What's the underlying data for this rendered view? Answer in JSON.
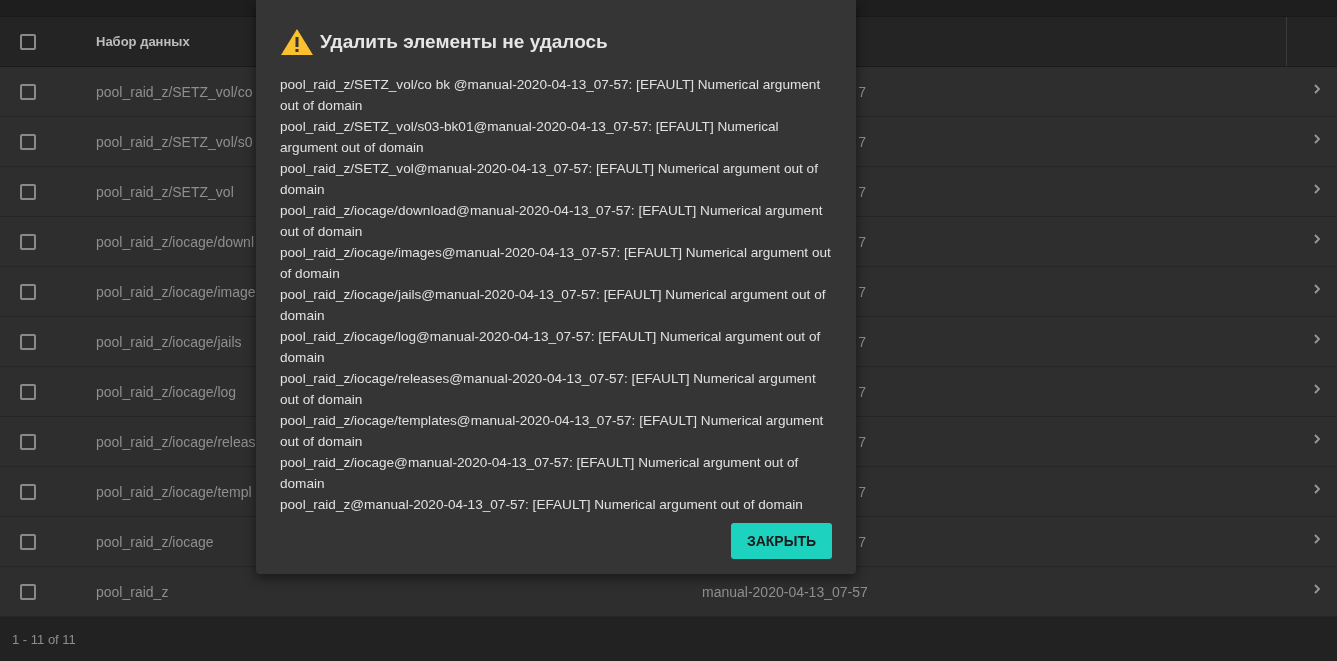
{
  "table": {
    "columns": [
      {
        "label": "Набор данных"
      }
    ],
    "rows": [
      {
        "checked": false,
        "dataset": "pool_raid_z/SETZ_vol/co",
        "snapshot": "7"
      },
      {
        "checked": false,
        "dataset": "pool_raid_z/SETZ_vol/s0",
        "snapshot": "7"
      },
      {
        "checked": false,
        "dataset": "pool_raid_z/SETZ_vol",
        "snapshot": "7"
      },
      {
        "checked": false,
        "dataset": "pool_raid_z/iocage/downl",
        "snapshot": "7"
      },
      {
        "checked": false,
        "dataset": "pool_raid_z/iocage/image",
        "snapshot": "7"
      },
      {
        "checked": false,
        "dataset": "pool_raid_z/iocage/jails",
        "snapshot": "7"
      },
      {
        "checked": false,
        "dataset": "pool_raid_z/iocage/log",
        "snapshot": "7"
      },
      {
        "checked": false,
        "dataset": "pool_raid_z/iocage/releas",
        "snapshot": "7"
      },
      {
        "checked": false,
        "dataset": "pool_raid_z/iocage/templ",
        "snapshot": "7"
      },
      {
        "checked": false,
        "dataset": "pool_raid_z/iocage",
        "snapshot": "7"
      },
      {
        "checked": false,
        "dataset": "pool_raid_z",
        "snapshot": "manual-2020-04-13_07-57"
      }
    ],
    "select_all": {
      "checked": false
    },
    "paginator": "1 - 11 of 11"
  },
  "dialog": {
    "title": "Удалить элементы не удалось",
    "messages": [
      "pool_raid_z/SETZ_vol/co bk @manual-2020-04-13_07-57: [EFAULT] Numerical argument out of domain",
      "pool_raid_z/SETZ_vol/s03-bk01@manual-2020-04-13_07-57: [EFAULT] Numerical argument out of domain",
      "pool_raid_z/SETZ_vol@manual-2020-04-13_07-57: [EFAULT] Numerical argument out of domain",
      "pool_raid_z/iocage/download@manual-2020-04-13_07-57: [EFAULT] Numerical argument out of domain",
      "pool_raid_z/iocage/images@manual-2020-04-13_07-57: [EFAULT] Numerical argument out of domain",
      "pool_raid_z/iocage/jails@manual-2020-04-13_07-57: [EFAULT] Numerical argument out of domain",
      "pool_raid_z/iocage/log@manual-2020-04-13_07-57: [EFAULT] Numerical argument out of domain",
      "pool_raid_z/iocage/releases@manual-2020-04-13_07-57: [EFAULT] Numerical argument out of domain",
      "pool_raid_z/iocage/templates@manual-2020-04-13_07-57: [EFAULT] Numerical argument out of domain",
      "pool_raid_z/iocage@manual-2020-04-13_07-57: [EFAULT] Numerical argument out of domain",
      "pool_raid_z@manual-2020-04-13_07-57: [EFAULT] Numerical argument out of domain"
    ],
    "button": "ЗАКРЫТЬ"
  }
}
